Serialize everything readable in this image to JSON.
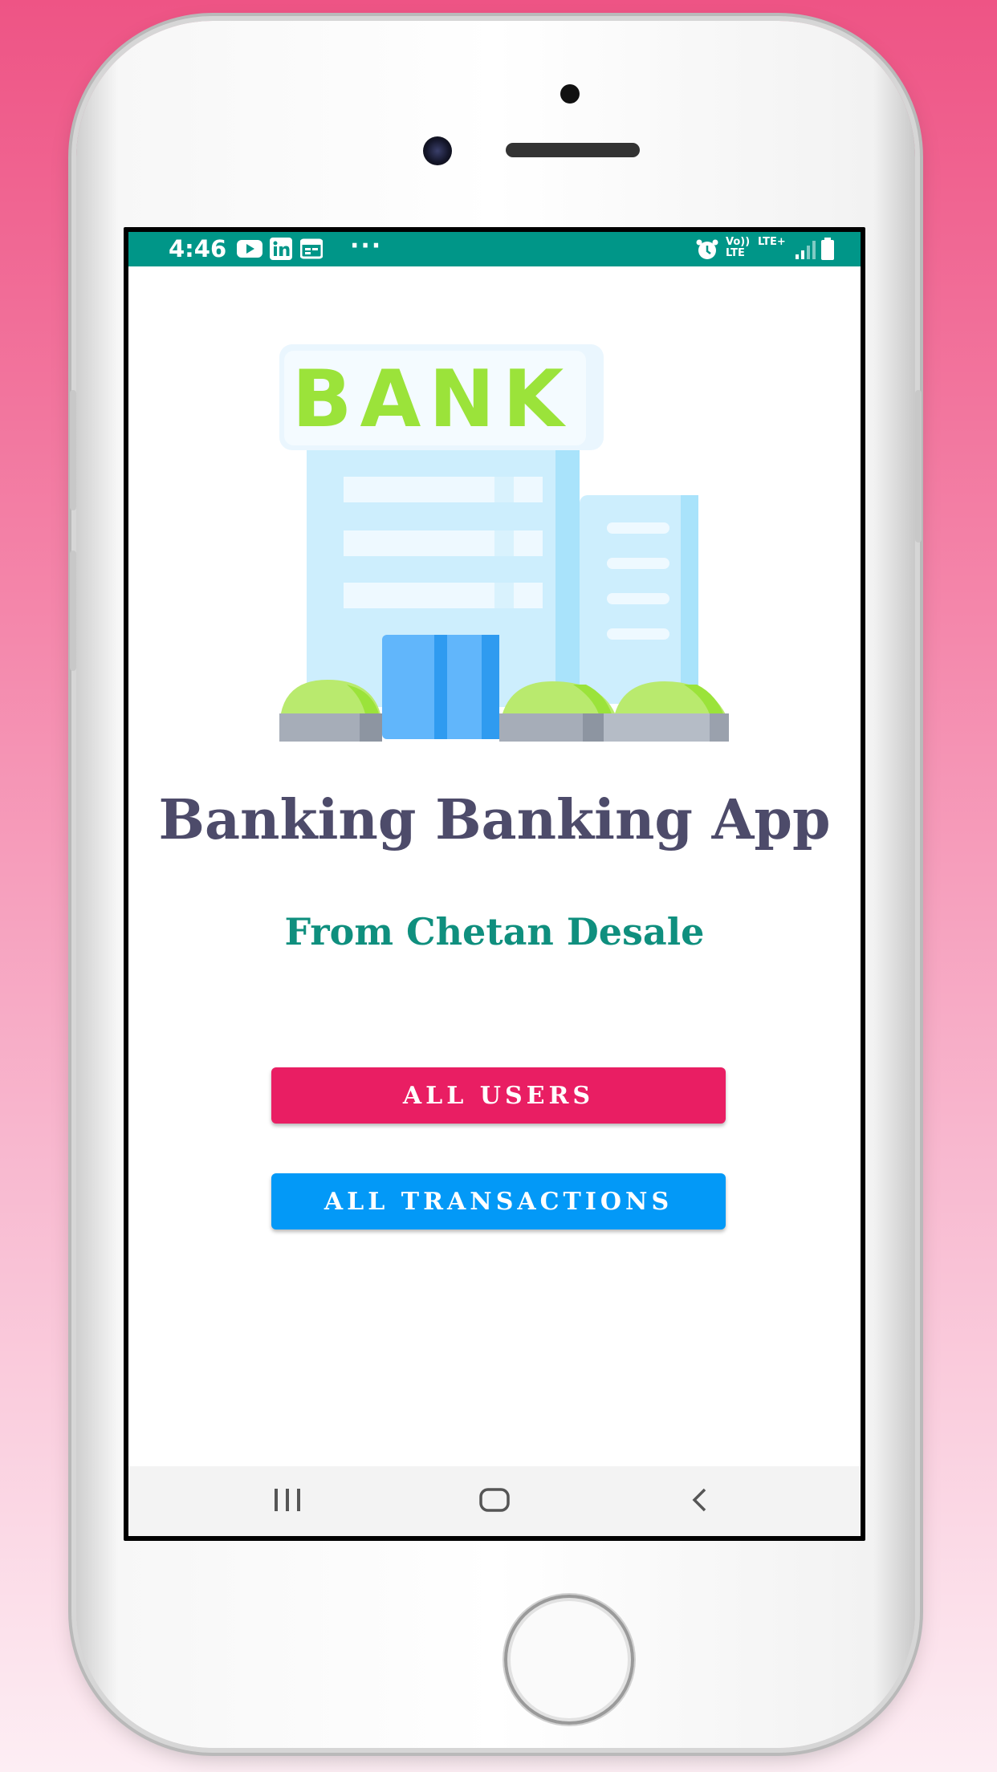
{
  "status_bar": {
    "time": "4:46",
    "left_icons": [
      "youtube-icon",
      "linkedin-icon",
      "calendar-icon"
    ],
    "more": "···",
    "right_icons": [
      "alarm-icon",
      "volte-icon",
      "lte-icon",
      "signal-icon",
      "battery-icon"
    ],
    "volte_label": "Vo)) LTE",
    "lte_label": "LTE+"
  },
  "hero": {
    "sign_text": "BANK"
  },
  "main": {
    "title": "Banking Banking App",
    "subtitle": "From Chetan Desale"
  },
  "buttons": {
    "all_users": "ALL USERS",
    "all_transactions": "ALL TRANSACTIONS"
  },
  "colors": {
    "status_bar": "#009688",
    "users_button": "#e91e63",
    "transactions_button": "#0399f7",
    "subtitle": "#0f8f7e",
    "title": "#4d4b6a"
  },
  "nav_bar": {
    "icons": [
      "recent-apps-icon",
      "home-icon",
      "back-icon"
    ]
  }
}
